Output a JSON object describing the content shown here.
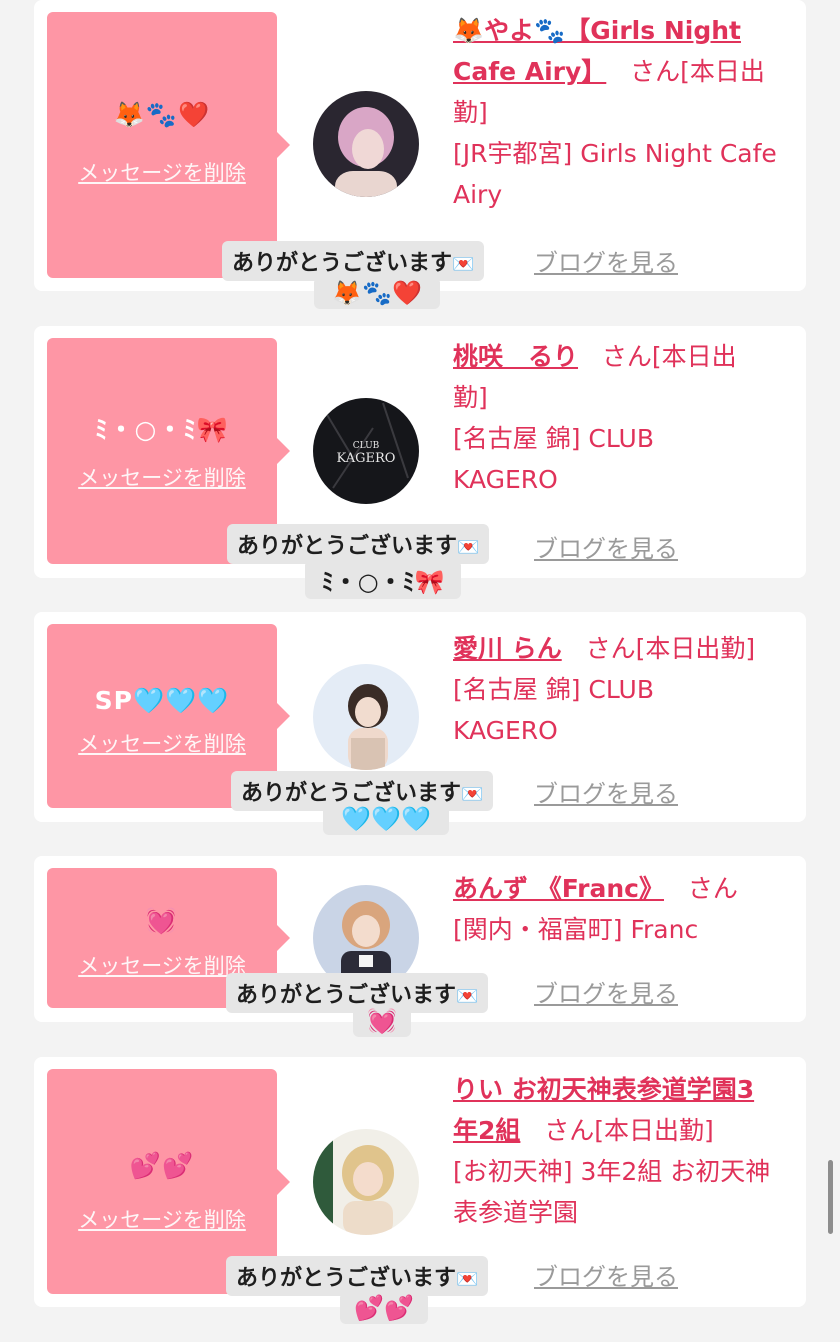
{
  "colors": {
    "accent": "#e0325a",
    "message_box": "#fe96a5",
    "card": "#ffffff",
    "background": "#f3f3f3"
  },
  "delete_label": "メッセージを削除",
  "blog_label": "ブログを見る",
  "thanks_text": "ありがとうございます",
  "envelope_icon": "💌",
  "cards": [
    {
      "message": "🦊🐾❤️",
      "name_line1": "🦊やよ🐾【Girls Night",
      "name_line2": "Cafe Airy】",
      "san": "さん",
      "status_part1": "[本日出",
      "status_part2": "勤]",
      "shop_line1": "[JR宇都宮] Girls Night Cafe",
      "shop_line2": "Airy",
      "reply": "🦊🐾❤️"
    },
    {
      "message": "ﾐ・○・ﾐ🎀",
      "name": "桃咲　るり",
      "san": "さん",
      "status_part1": "[本日出",
      "status_part2": "勤]",
      "shop_line1": "[名古屋 錦] CLUB",
      "shop_line2": "KAGERO",
      "reply": "ﾐ・○・ﾐ🎀"
    },
    {
      "message": "SP🩵🩵🩵",
      "name": "愛川 らん",
      "san": "さん",
      "status": "[本日出勤]",
      "shop_line1": "[名古屋 錦] CLUB",
      "shop_line2": "KAGERO",
      "reply": "🩵🩵🩵"
    },
    {
      "message": "💓",
      "name": "あんず 《Franc》",
      "san": "さん",
      "shop_line1": "[関内・福富町] Franc",
      "reply": "💓"
    },
    {
      "message": "💕💕",
      "name_line1": "りい お初天神表参道学園3",
      "name_line2": "年2組",
      "san": "さん",
      "status": "[本日出勤]",
      "shop_line1": "[お初天神] 3年2組 お初天神",
      "shop_line2": "表参道学園",
      "reply": "💕💕"
    }
  ]
}
